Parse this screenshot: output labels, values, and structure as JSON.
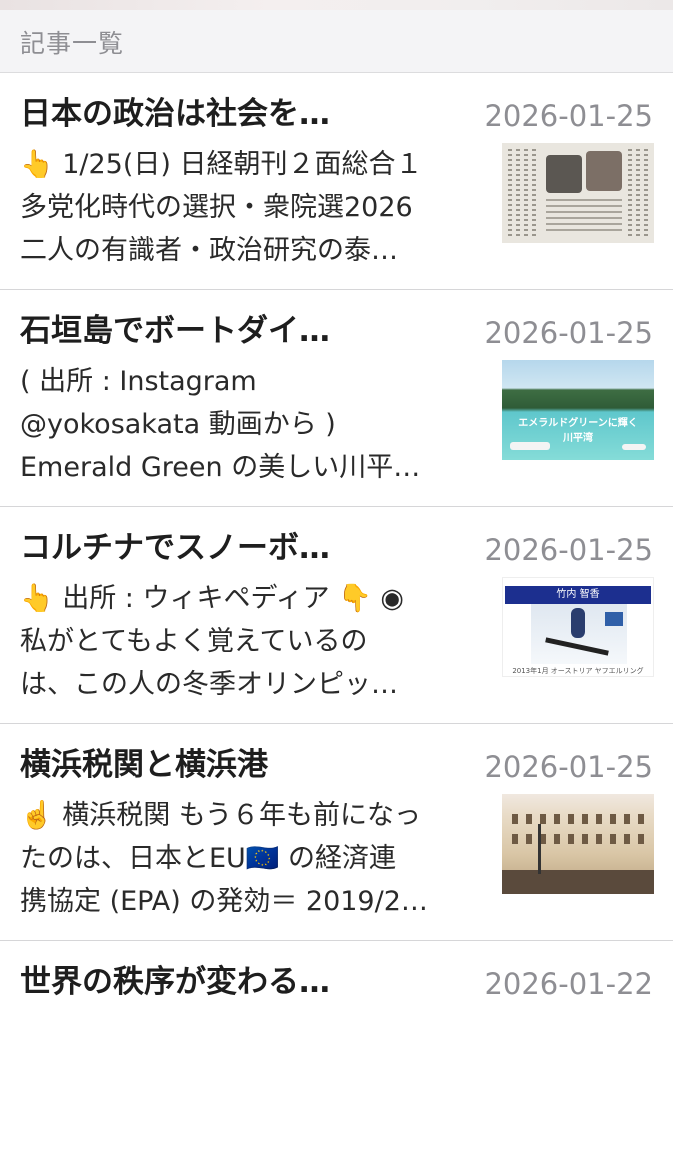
{
  "header": {
    "title": "記事一覧"
  },
  "articles": [
    {
      "title": "日本の政治は社会を…",
      "date": "2026-01-25",
      "lines": [
        "👆 1/25(日) 日経朝刊２面総合１",
        "多党化時代の選択・衆院選2026",
        "二人の有識者・政治研究の泰…"
      ],
      "thumbnail": "newspaper-thumbnail"
    },
    {
      "title": "石垣島でボートダイ…",
      "date": "2026-01-25",
      "lines": [
        "( 出所 : Instagram",
        "@yokosakata 動画から )",
        "Emerald Green の美しい川平…"
      ],
      "thumbnail": "beach-thumbnail",
      "thumbnail_caption": "エメラルドグリーンに輝く\n川平湾"
    },
    {
      "title": "コルチナでスノーボ…",
      "date": "2026-01-25",
      "lines": [
        "👆 出所 : ウィキペディア 👇 ◉",
        "私がとてもよく覚えているの",
        "は、この人の冬季オリンピッ…"
      ],
      "thumbnail": "snowboard-thumbnail",
      "thumbnail_title": "竹内 智香",
      "thumbnail_caption": "2013年1月 オーストリア ヤフエルリング"
    },
    {
      "title": "横浜税関と横浜港",
      "date": "2026-01-25",
      "lines": [
        "☝️ 横浜税関 もう６年も前になっ",
        "たのは、日本とEU🇪🇺 の経済連",
        "携協定 (EPA) の発効＝ 2019/2…"
      ],
      "thumbnail": "building-thumbnail"
    },
    {
      "title": "世界の秩序が変わる…",
      "date": "2026-01-22",
      "lines": [],
      "thumbnail": "partial-thumbnail"
    }
  ]
}
